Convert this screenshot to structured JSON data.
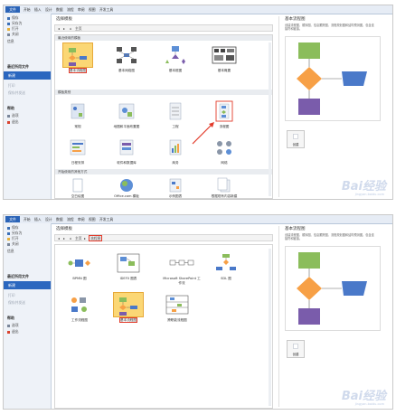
{
  "ribbon": {
    "tabs": [
      "文件",
      "开始",
      "插入",
      "设计",
      "数据",
      "流程",
      "审阅",
      "视图",
      "开发工具"
    ]
  },
  "sidebar": {
    "items": [
      {
        "label": "保存",
        "icon": "save-icon",
        "color": "#3b6fb6"
      },
      {
        "label": "另存为",
        "icon": "save-as-icon",
        "color": "#3b6fb6"
      },
      {
        "label": "打开",
        "icon": "open-folder-icon",
        "color": "#e7b23b"
      },
      {
        "label": "关闭",
        "icon": "close-file-icon",
        "color": "#7a8699"
      },
      {
        "label": "信息",
        "icon": "info-icon",
        "color": "#7a8699"
      }
    ],
    "recent": "最近所用文件",
    "new": "新建",
    "print": "打印",
    "save_send": "保存并发送",
    "help": "帮助",
    "options": "选项",
    "exit": "退出"
  },
  "shot1": {
    "title": "选择模板",
    "nav_home": "主页",
    "section_recent": "最近使用的模板",
    "recent_tiles": [
      {
        "label": "基本流程图",
        "selected": true
      },
      {
        "label": "基本网络图",
        "selected": false
      },
      {
        "label": "基本框图",
        "selected": false
      },
      {
        "label": "基本概要",
        "selected": false
      }
    ],
    "section_categories": "模板类别",
    "category_tiles": [
      {
        "label": "常规"
      },
      {
        "label": "地图和平面布置图"
      },
      {
        "label": "工程"
      },
      {
        "label": "流程图"
      },
      {
        "label": "日程安排"
      },
      {
        "label": "软件和数据库"
      },
      {
        "label": "商务"
      },
      {
        "label": "网络"
      }
    ],
    "section_other": "开始使用的其他方式",
    "other_tiles": [
      {
        "label": "空白绘图"
      },
      {
        "label": "Office.com 模板"
      },
      {
        "label": "示例图表"
      },
      {
        "label": "根据现有内容新建"
      }
    ]
  },
  "shot2": {
    "title": "选择模板",
    "nav_home": "主页",
    "nav_current": "流程图",
    "tiles_row1": [
      {
        "label": "BPMN 图"
      },
      {
        "label": "IDEF0 图表"
      },
      {
        "label": "Microsoft SharePoint 工作流"
      },
      {
        "label": "SDL 图"
      }
    ],
    "tiles_row2": [
      {
        "label": "工作流程图",
        "selected": false
      },
      {
        "label": "基本流程图",
        "selected": true
      },
      {
        "label": "跨职能流程图",
        "selected": false
      }
    ]
  },
  "preview": {
    "title": "基本流程图",
    "description": "创建流程图、顺序图、信息跟踪图、流程规划图和结构预测图，包含连接符和链接。",
    "create_label": "创建"
  },
  "watermark": {
    "text": "Bai经验",
    "sub": "jingyan.baidu.com"
  },
  "colors": {
    "file_tab": "#2a63b7",
    "new_item": "#2b67bf",
    "selected_tile": "#fbd775",
    "highlight_red": "#e23a2a",
    "shape_green": "#8bbd5b",
    "shape_orange": "#f7a046",
    "shape_blue": "#4a79c9",
    "shape_purple": "#7a5cab"
  }
}
